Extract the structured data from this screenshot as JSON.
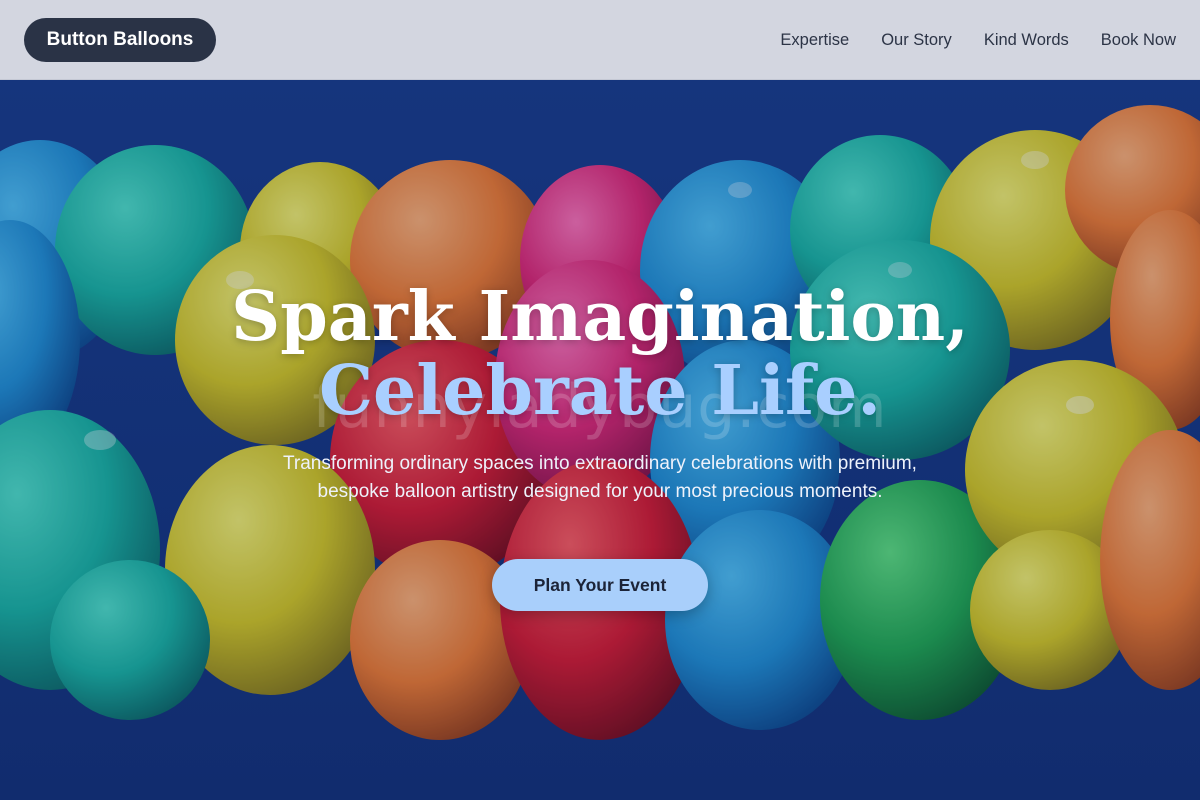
{
  "header": {
    "brand": "Button Balloons",
    "nav": [
      "Expertise",
      "Our Story",
      "Kind Words",
      "Book Now"
    ]
  },
  "hero": {
    "headline_line1": "Spark Imagination,",
    "headline_line2": "Celebrate Life.",
    "subtext": "Transforming ordinary spaces into extraordinary celebrations with premium, bespoke balloon artistry designed for your most precious moments.",
    "cta": "Plan Your Event",
    "watermark": "funnyladybug.com",
    "image": "colorful-balloon-garland-photo"
  },
  "colors": {
    "header_bg": "#d3d6e0",
    "brand_bg": "#2a3346",
    "hero_bg": "#14306e",
    "accent": "#a9cffb",
    "headline_accent": "#a9cfff"
  }
}
